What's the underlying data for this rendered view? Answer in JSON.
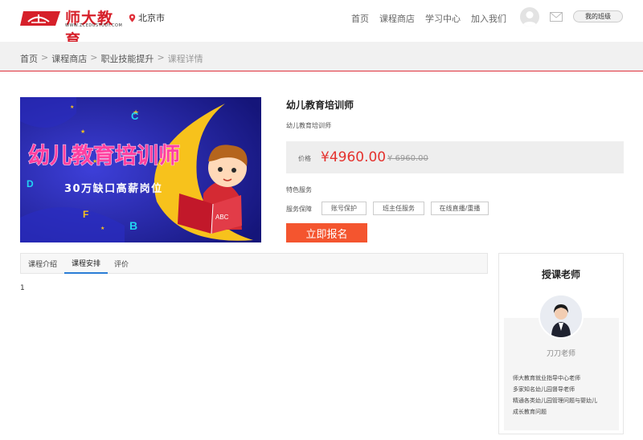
{
  "header": {
    "logo_text": "师大教育",
    "logo_url": "WWW.ZCEDUSTUDY.COM",
    "city": "北京市",
    "nav": [
      "首页",
      "课程商店",
      "学习中心",
      "加入我们"
    ],
    "my_class": "我的班级"
  },
  "breadcrumb": {
    "items": [
      "首页",
      "课程商店",
      "职业技能提升"
    ],
    "separator": ">",
    "current": "课程详情"
  },
  "banner": {
    "title_line": "幼儿教育培训师",
    "subtitle": "30万缺口高薪岗位",
    "letters": [
      "C",
      "D",
      "F",
      "B",
      "ABC"
    ]
  },
  "course": {
    "title": "幼儿教育培训师",
    "subtitle": "幼儿教育培训师",
    "price_label": "价格",
    "price": "¥4960.00",
    "original_price": "¥ 6960.00",
    "features_label": "特色服务",
    "guarantee_label": "服务保障",
    "tags": [
      "账号保护",
      "班主任服务",
      "在线直播/重播"
    ],
    "signup_label": "立即报名"
  },
  "tabs": {
    "items": [
      "课程介绍",
      "课程安排",
      "评价"
    ],
    "active_index": 1,
    "body": "1"
  },
  "teacher": {
    "heading": "授课老师",
    "name": "刀刀老师",
    "description": [
      "师大教育就业指导中心老师",
      "多家知名幼儿园督导老师",
      "精通各类幼儿园管理问题与婴幼儿",
      "成长教育问题"
    ]
  },
  "colors": {
    "brand_red": "#d6202a",
    "price_red": "#e4322e",
    "signup_orange": "#f4552f",
    "tab_active_blue": "#2a7dd6",
    "banner_blue": "#1d1f9e",
    "moon_yellow": "#f7c21c",
    "banner_text_pink": "#ff3fa0"
  },
  "icons": {
    "location": "location-pin-icon",
    "avatar": "user-avatar-icon",
    "mail": "mail-icon"
  }
}
